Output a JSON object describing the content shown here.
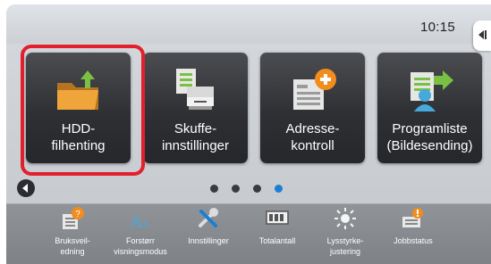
{
  "status": {
    "clock": "10:15"
  },
  "tiles": [
    {
      "label": "HDD-\nfilhenting",
      "icon": "folder-download-icon",
      "selected": true
    },
    {
      "label": "Skuffe-\ninnstillinger",
      "icon": "paper-tray-icon",
      "selected": false
    },
    {
      "label": "Adresse-\nkontroll",
      "icon": "address-add-icon",
      "selected": false
    },
    {
      "label": "Programliste\n(Bildesending)",
      "icon": "program-list-send-icon",
      "selected": false
    }
  ],
  "pager": {
    "page_count": 4,
    "active_page": 4
  },
  "bottom_bar": [
    {
      "label": "Bruksveil-\nedning",
      "icon": "manual-help-icon"
    },
    {
      "label": "Forstørr\nvisningsmodus",
      "icon": "enlarge-display-icon"
    },
    {
      "label": "Innstillinger",
      "icon": "tools-icon"
    },
    {
      "label": "Totalantall",
      "icon": "counter-icon"
    },
    {
      "label": "Lysstyrke-\njustering",
      "icon": "brightness-icon"
    },
    {
      "label": "Jobbstatus",
      "icon": "job-status-icon"
    }
  ],
  "colors": {
    "highlight": "#e2202d",
    "active_dot": "#1a7fd4",
    "tile_bg": "#2f3034"
  }
}
